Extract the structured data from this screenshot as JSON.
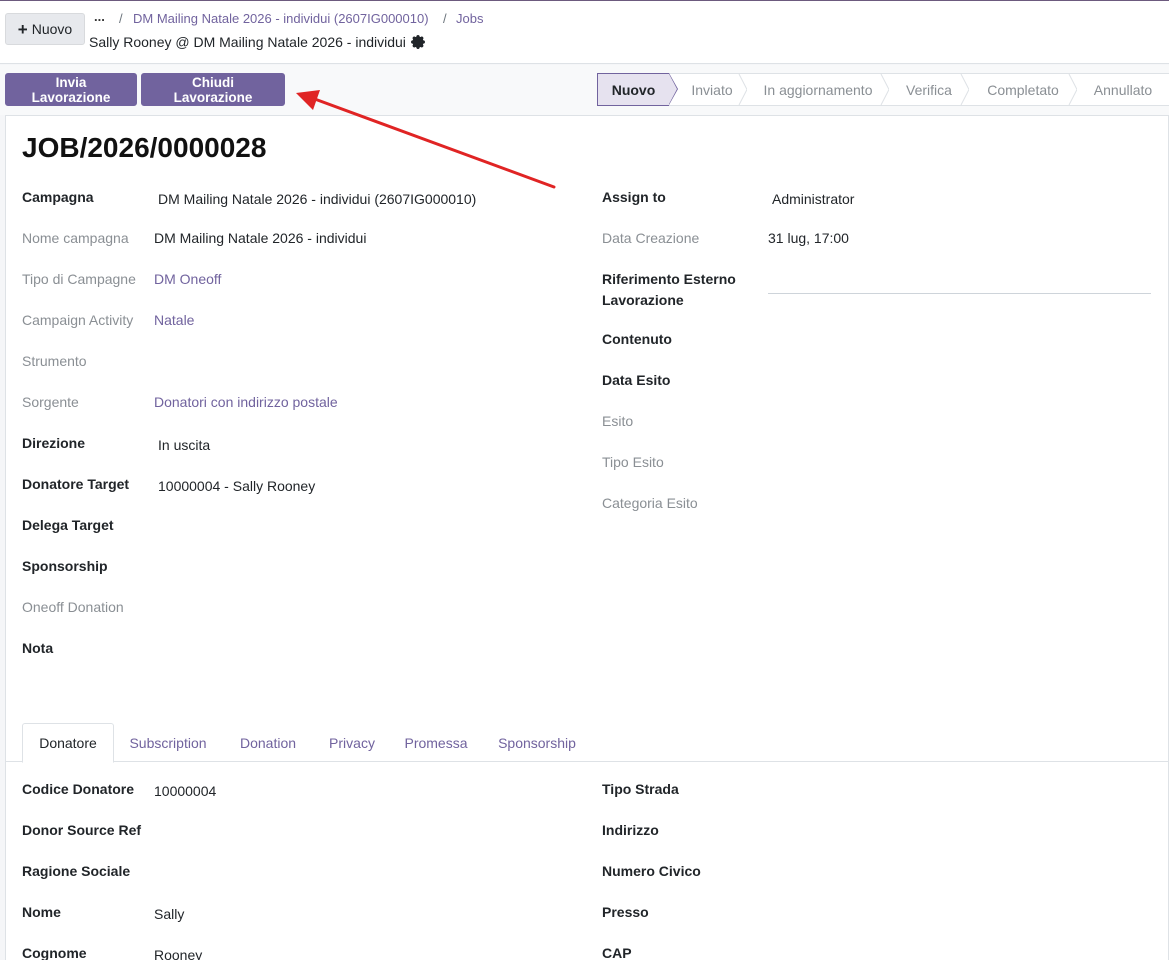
{
  "control_panel": {
    "new_button": "Nuovo",
    "breadcrumb_dots": "...",
    "breadcrumb_sep": "/",
    "breadcrumbs": [
      "DM Mailing Natale 2026 - individui (2607IG000010)",
      "Jobs"
    ],
    "record_name": "Sally Rooney @ DM Mailing Natale 2026 - individui",
    "settings_icon": "gear-icon"
  },
  "actions": {
    "send_button": "Invia Lavorazione",
    "close_button": "Chiudi Lavorazione"
  },
  "statusbar": {
    "stages": [
      "Nuovo",
      "Inviato",
      "In aggiornamento",
      "Verifica",
      "Completato",
      "Annullato"
    ],
    "active": "Nuovo"
  },
  "record": {
    "title": "JOB/2026/0000028"
  },
  "left_fields": {
    "campagna_label": "Campagna",
    "campagna_value": "DM Mailing Natale 2026 -  individui (2607IG000010)",
    "nome_campagna_label": "Nome campagna",
    "nome_campagna_value": "DM Mailing Natale 2026 - individui",
    "tipo_campagne_label": "Tipo di Campagne",
    "tipo_campagne_value": "DM Oneoff",
    "campaign_activity_label": "Campaign Activity",
    "campaign_activity_value": "Natale",
    "strumento_label": "Strumento",
    "sorgente_label": "Sorgente",
    "sorgente_value": "Donatori con indirizzo postale",
    "direzione_label": "Direzione",
    "direzione_value": "In uscita",
    "donatore_target_label": "Donatore Target",
    "donatore_target_value": "10000004 - Sally Rooney",
    "delega_target_label": "Delega Target",
    "sponsorship_label": "Sponsorship",
    "oneoff_donation_label": "Oneoff Donation",
    "nota_label": "Nota"
  },
  "right_fields": {
    "assign_to_label": "Assign to",
    "assign_to_value": "Administrator",
    "data_creazione_label": "Data Creazione",
    "data_creazione_value": "31 lug, 17:00",
    "riferimento_label_1": "Riferimento Esterno",
    "riferimento_label_2": "Lavorazione",
    "contenuto_label": "Contenuto",
    "data_esito_label": "Data Esito",
    "esito_label": "Esito",
    "tipo_esito_label": "Tipo Esito",
    "categoria_esito_label": "Categoria Esito"
  },
  "tabs": [
    "Donatore",
    "Subscription",
    "Donation",
    "Privacy",
    "Promessa",
    "Sponsorship"
  ],
  "donatore_tab": {
    "codice_donatore_label": "Codice Donatore",
    "codice_donatore_value": "10000004",
    "donor_source_ref_label": "Donor Source Ref",
    "ragione_sociale_label": "Ragione Sociale",
    "nome_label": "Nome",
    "nome_value": "Sally",
    "cognome_label": "Cognome",
    "cognome_value": "Rooney",
    "tipo_strada_label": "Tipo Strada",
    "indirizzo_label": "Indirizzo",
    "numero_civico_label": "Numero Civico",
    "presso_label": "Presso",
    "cap_label": "CAP"
  },
  "colors": {
    "primary": "#71639e",
    "annotation_arrow": "#e02424"
  }
}
